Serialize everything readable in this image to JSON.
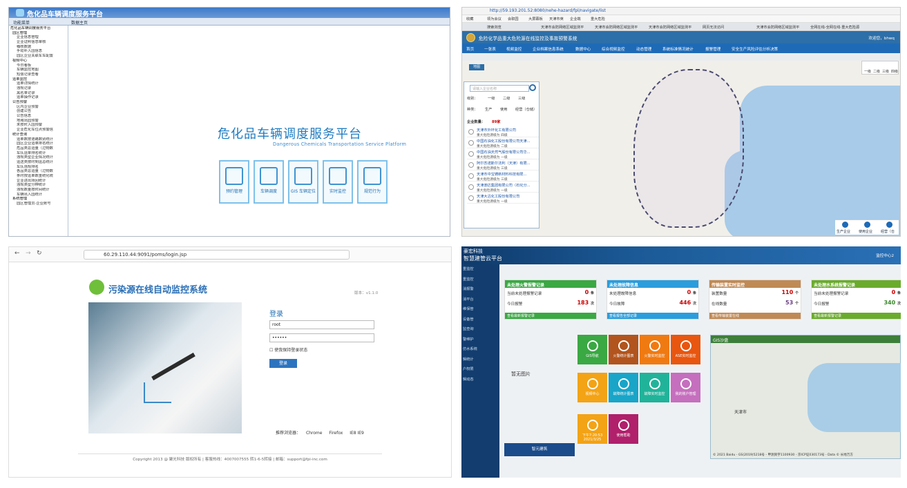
{
  "panel1": {
    "app_title": "危化品车辆调度服务平台",
    "tab_menu": "功能菜单",
    "tab_home": "数据主页",
    "tree": [
      {
        "label": "危化品车辆调度服务平台",
        "lvl": 0
      },
      {
        "label": "园区管理",
        "lvl": 1
      },
      {
        "label": "企业信息管理",
        "lvl": 2
      },
      {
        "label": "企业证照信息审核",
        "lvl": 2
      },
      {
        "label": "稽核数据",
        "lvl": 2
      },
      {
        "label": "手动补入园信息",
        "lvl": 2
      },
      {
        "label": "园区企业关联车车配置",
        "lvl": 2
      },
      {
        "label": "视频中心",
        "lvl": 1
      },
      {
        "label": "今日看板",
        "lvl": 2
      },
      {
        "label": "车辆监控地图",
        "lvl": 2
      },
      {
        "label": "短信记录查看",
        "lvl": 2
      },
      {
        "label": "运单监控",
        "lvl": 1
      },
      {
        "label": "运单详情统计",
        "lvl": 2
      },
      {
        "label": "违规记录",
        "lvl": 2
      },
      {
        "label": "黑名单记录",
        "lvl": 2
      },
      {
        "label": "运单操作记录",
        "lvl": 2
      },
      {
        "label": "公告预警",
        "lvl": 1
      },
      {
        "label": "区内企业预警",
        "lvl": 2
      },
      {
        "label": "创建公告",
        "lvl": 2
      },
      {
        "label": "公告信息",
        "lvl": 2
      },
      {
        "label": "地域出园预警",
        "lvl": 2
      },
      {
        "label": "未按时入园预警",
        "lvl": 2
      },
      {
        "label": "企业危化车位点预警信",
        "lvl": 2
      },
      {
        "label": "统计查询",
        "lvl": 1
      },
      {
        "label": "运单数按道路数别统计",
        "lvl": 2
      },
      {
        "label": "园区企业运单排名统计",
        "lvl": 2
      },
      {
        "label": "危品类总运量（过物数",
        "lvl": 2
      },
      {
        "label": "车队运单排名统计",
        "lvl": 2
      },
      {
        "label": "违规类型企业情况统计",
        "lvl": 2
      },
      {
        "label": "运送类按时到运总统计",
        "lvl": 2
      },
      {
        "label": "车队违规排名",
        "lvl": 2
      },
      {
        "label": "各品类总运量（过物数",
        "lvl": 2
      },
      {
        "label": "条时按运单数重统化统",
        "lvl": 2
      },
      {
        "label": "企业进出场回统计",
        "lvl": 2
      },
      {
        "label": "违规类型分辨统计",
        "lvl": 2
      },
      {
        "label": "违规数量按时间统计",
        "lvl": 2
      },
      {
        "label": "车辆出入园统计",
        "lvl": 2
      },
      {
        "label": "系统管理",
        "lvl": 1
      },
      {
        "label": "园区管理员-企业账号",
        "lvl": 2
      }
    ],
    "big_title": "危化品车辆调度服务平台",
    "subtitle": "Dangerous Chemicals Transportation Service Platform",
    "tiles": [
      {
        "label": "预约管理"
      },
      {
        "label": "车辆调度"
      },
      {
        "label": "GIS 车辆定位"
      },
      {
        "label": "实时监控"
      },
      {
        "label": "规范行为"
      }
    ]
  },
  "panel2": {
    "url": "http://59.193.201.52:8080/nehe-hazard/fpl/navigate/list",
    "bookmarks": [
      "收藏",
      "领为会议",
      "会职园",
      "大屏幕板",
      "天津市英",
      "企业端",
      "重大危险"
    ],
    "tabs": [
      "搜索浏览",
      "天津市会防网络区域监测平",
      "天津市会防网络区域监测平",
      "天津市会防网络区域监测平",
      "网页无法访问",
      "天津市会防网络区域监测平",
      "全网在线-全网在线-重大危险源"
    ],
    "banner_title": "危险化学品重大危险源在线监控及事故预警系统",
    "user": "欢迎您，bhwq",
    "nav": [
      "首页",
      "一张表",
      "视频监控",
      "企业档案信息系统",
      "数据中心",
      "综合视频监控",
      "动态管理",
      "系统标准情况统计",
      "报警管理",
      "安全生产风险评估分析决策"
    ],
    "zoom_label": "地图",
    "search_placeholder": "请输入企业名称",
    "level_label": "级别：",
    "levels": [
      "一级",
      "二级",
      "三级"
    ],
    "kind_label": "种类：",
    "kinds": [
      "生产",
      "使用",
      "经营（仓储）"
    ],
    "count_label": "企业数量：",
    "count_value": "89家",
    "companies": [
      {
        "name": "天津市外环化工有限公司",
        "level": "重大危险源级为 四级"
      },
      {
        "name": "中国石油化工股份有限公司天津...",
        "level": "重大危险源级为 二级"
      },
      {
        "name": "中国石油天然气股份有限公司华...",
        "level": "重大危险源级为 一级"
      },
      {
        "name": "阿尔苏诺斯尔法利（天津）有限...",
        "level": "重大危险源级为 三级"
      },
      {
        "name": "天津市中宝铸新材料科技有限...",
        "level": "重大危险源级为 三级"
      },
      {
        "name": "天津渤达集团有限公司（石化分...",
        "level": "重大危险源级为 一级"
      },
      {
        "name": "天津大沽化工股份有限公司",
        "level": "重大危险源级为 一级"
      }
    ],
    "legend": [
      "一级",
      "二级",
      "三级",
      "四级"
    ],
    "bottom": [
      "生产企业",
      "使用企业",
      "经营（仓"
    ]
  },
  "panel3": {
    "url": "60.29.110.44:9091/poms/login.jsp",
    "title": "污染源在线自动监控系统",
    "version": "版本：v1.1.0",
    "login_title": "登录",
    "username": "root",
    "password": "••••••",
    "remember": "使我保持登录状态",
    "login_btn": "登录",
    "browsers_label": "推荐浏览器：",
    "browsers": [
      "Chrome",
      "Firefox",
      "IE8 IE9"
    ],
    "copyright": "Copyright 2013 @ 聚光科技 版权所有 | 客服热线：4007007555 转1-6-5转接 | 邮箱：support@fpi-inc.com"
  },
  "panel4": {
    "brand1": "豪宏科技",
    "brand2": "智慧建管云平台",
    "top_right": "监控中心2",
    "side": [
      "重监控",
      "重监控",
      "消报警",
      "消平台",
      "维保管",
      "设备管",
      "监查询",
      "警维护",
      "仿水系统",
      "辑统计",
      "户权限",
      "辑动态"
    ],
    "cards": [
      {
        "title": "未处理火警报警记录",
        "color": "#3aa843",
        "r1": "当前未处理报警记录",
        "v1": "0",
        "u1": "条",
        "r2": "今日报警",
        "v2": "183",
        "u2": "次",
        "foot": "查看最新报警记录"
      },
      {
        "title": "未处理故障信息",
        "color": "#2b9ddc",
        "r1": "未处理故障信息",
        "v1": "0",
        "u1": "条",
        "r2": "今日故障",
        "v2": "446",
        "u2": "次",
        "foot": "查看报告全部记录"
      },
      {
        "title": "传输装置实时监控",
        "color": "#c08a55",
        "r1": "装置数量",
        "v1": "110",
        "u1": "个",
        "r2": "在线数量",
        "v2": "53",
        "u2": "个",
        "foot": "查看传输装置在线"
      },
      {
        "title": "未处理水系统报警记录",
        "color": "#6aab2c",
        "r1": "当前未处理报警记录",
        "v1": "0",
        "u1": "条",
        "r2": "今日报警",
        "v2": "340",
        "u2": "次",
        "foot": "查看最新报警记录"
      }
    ],
    "no_image": "暂无图片",
    "bottom_btn": "智元建筑",
    "tiles": [
      {
        "label": "GIS导航",
        "color": "#3aa843"
      },
      {
        "label": "火警统计图表",
        "color": "#b2541d"
      },
      {
        "label": "火警实时监控",
        "color": "#f07a12"
      },
      {
        "label": "ASE实时监控",
        "color": "#e8560f"
      },
      {
        "label": "视频中心",
        "color": "#f3a316"
      },
      {
        "label": "故障统计图表",
        "color": "#18a5c8"
      },
      {
        "label": "故障实时监控",
        "color": "#21b39a"
      },
      {
        "label": "我的账户管理",
        "color": "#c56fbe"
      },
      {
        "label": "下午7:20:53 2021/3/25",
        "color": "#f3a316"
      },
      {
        "label": "使用帮助",
        "color": "#b0206b"
      }
    ],
    "gis_title": "GIS沙盘",
    "gis_city": "天津市",
    "gis_copy": "© 2021 Baidu - GS(2019)5218号 - 甲测资字1100930 - 京ICP证030173号 - Data © 长地万方"
  }
}
